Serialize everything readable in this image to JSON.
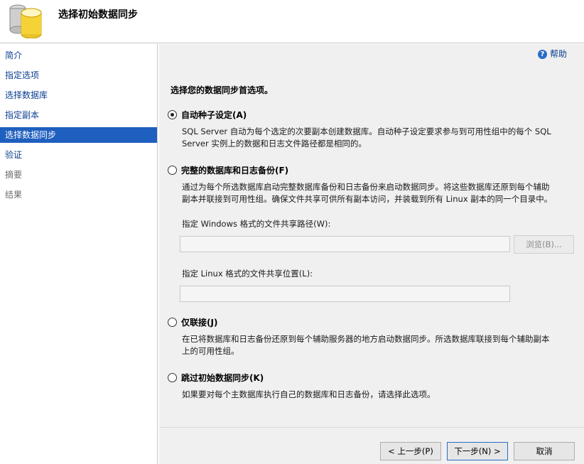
{
  "header": {
    "title": "选择初始数据同步",
    "icon": "database-icon"
  },
  "sidebar": {
    "items": [
      {
        "label": "简介",
        "state": "link"
      },
      {
        "label": "指定选项",
        "state": "link"
      },
      {
        "label": "选择数据库",
        "state": "link"
      },
      {
        "label": "指定副本",
        "state": "link"
      },
      {
        "label": "选择数据同步",
        "state": "active"
      },
      {
        "label": "验证",
        "state": "link"
      },
      {
        "label": "摘要",
        "state": "disabled"
      },
      {
        "label": "结果",
        "state": "disabled"
      }
    ]
  },
  "main": {
    "help_label": "帮助",
    "prompt": "选择您的数据同步首选项。",
    "options": [
      {
        "label": "自动种子设定(A)",
        "checked": true,
        "description_lines": [
          "SQL Server 自动为每个选定的次要副本创建数据库。自动种子设定要求参与到可用性组中的每个 SQL",
          "Server 实例上的数据和日志文件路径都是相同的。"
        ]
      },
      {
        "label": "完整的数据库和日志备份(F)",
        "checked": false,
        "description_lines": [
          "通过为每个所选数据库启动完整数据库备份和日志备份来启动数据同步。将这些数据库还原到每个辅助",
          "副本并联接到可用性组。确保文件共享可供所有副本访问，并装载到所有 Linux 副本的同一个目录中。"
        ]
      },
      {
        "label": "仅联接(J)",
        "checked": false,
        "description_lines": [
          "在已将数据库和日志备份还原到每个辅助服务器的地方启动数据同步。所选数据库联接到每个辅助副本",
          "上的可用性组。"
        ]
      },
      {
        "label": "跳过初始数据同步(K)",
        "checked": false,
        "description_lines": [
          "如果要对每个主数据库执行自己的数据库和日志备份，请选择此选项。"
        ]
      }
    ],
    "windows_share": {
      "label": "指定 Windows 格式的文件共享路径(W):",
      "value": "",
      "browse_label": "浏览(B)..."
    },
    "linux_share": {
      "label": "指定 Linux 格式的文件共享位置(L):",
      "value": ""
    }
  },
  "footer": {
    "prev_label": "< 上一步(P)",
    "next_label": "下一步(N) >",
    "cancel_label": "取消"
  },
  "colors": {
    "active_nav_bg": "#1f5fbf",
    "link": "#0b3d91",
    "panel_bg": "#f0f0f0"
  }
}
